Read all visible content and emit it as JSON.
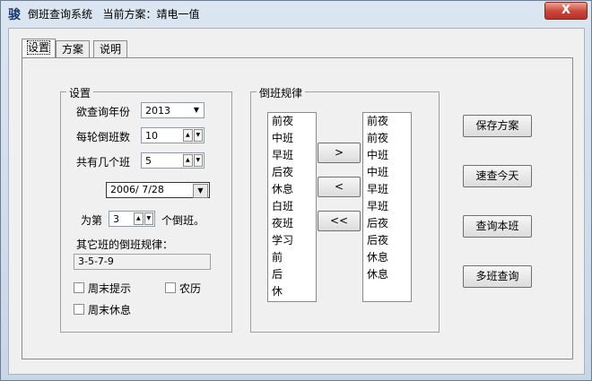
{
  "window": {
    "icon": "骏",
    "title": "倒班查询系统",
    "plan_prefix": "当前方案：",
    "plan_name": "靖电一值",
    "close_glyph": "X"
  },
  "tabs": [
    {
      "label": "设置",
      "active": true
    },
    {
      "label": "方案",
      "active": false
    },
    {
      "label": "说明",
      "active": false
    }
  ],
  "settings": {
    "group_label": "设置",
    "year_label": "欲查询年份",
    "year_value": "2013",
    "rotation_label": "每轮倒班数",
    "rotation_value": "10",
    "shifts_label": "共有几个班",
    "shifts_value": "5",
    "date_value": "2006/ 7/28",
    "which_prefix": "为第",
    "which_value": "3",
    "which_suffix": "个倒班。",
    "other_rule_label": "其它班的倒班规律：",
    "other_rule_value": "3-5-7-9",
    "weekend_remind": "周末提示",
    "lunar": "农历",
    "weekend_off": "周末休息"
  },
  "rules": {
    "group_label": "倒班规律",
    "source_items": [
      "前夜",
      "中班",
      "早班",
      "后夜",
      "休息",
      "白班",
      "夜班",
      "学习",
      "前",
      "后",
      "休"
    ],
    "target_items": [
      "前夜",
      "前夜",
      "中班",
      "中班",
      "早班",
      "早班",
      "后夜",
      "后夜",
      "休息",
      "休息"
    ],
    "add_button": ">",
    "remove_button": "<",
    "clear_button": "<<"
  },
  "actions": {
    "save": "保存方案",
    "today": "速查今天",
    "query_this": "查询本班",
    "multi_query": "多班查询"
  },
  "icons": {
    "dropdown": "chevron-down-icon",
    "spin_up": "▲",
    "spin_down": "▼",
    "dropdown_glyph": "▼"
  }
}
